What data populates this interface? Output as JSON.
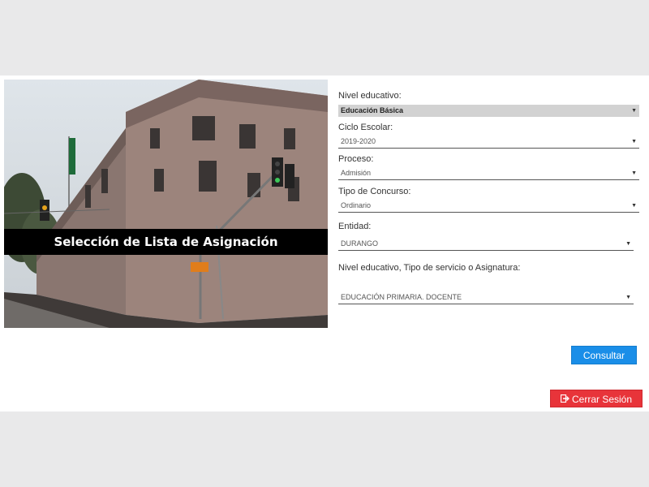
{
  "hero": {
    "title": "Selección de Lista de Asignación"
  },
  "form": {
    "fields": [
      {
        "label": "Nivel educativo:",
        "value": "Educación Básica"
      },
      {
        "label": "Ciclo Escolar:",
        "value": "2019-2020"
      },
      {
        "label": "Proceso:",
        "value": "Admisión"
      },
      {
        "label": "Tipo de Concurso:",
        "value": "Ordinario"
      },
      {
        "label": "Entidad:",
        "value": "DURANGO"
      },
      {
        "label": "Nivel educativo, Tipo de servicio o Asignatura:",
        "value": "EDUCACIÓN PRIMARIA. DOCENTE"
      }
    ],
    "arrow_icon": "▼"
  },
  "buttons": {
    "consult_label": "Consultar",
    "logout_label": "Cerrar Sesión",
    "logout_icon": "sign-out-icon"
  },
  "colors": {
    "consult": "#1a8ee8",
    "logout": "#e8343a"
  }
}
